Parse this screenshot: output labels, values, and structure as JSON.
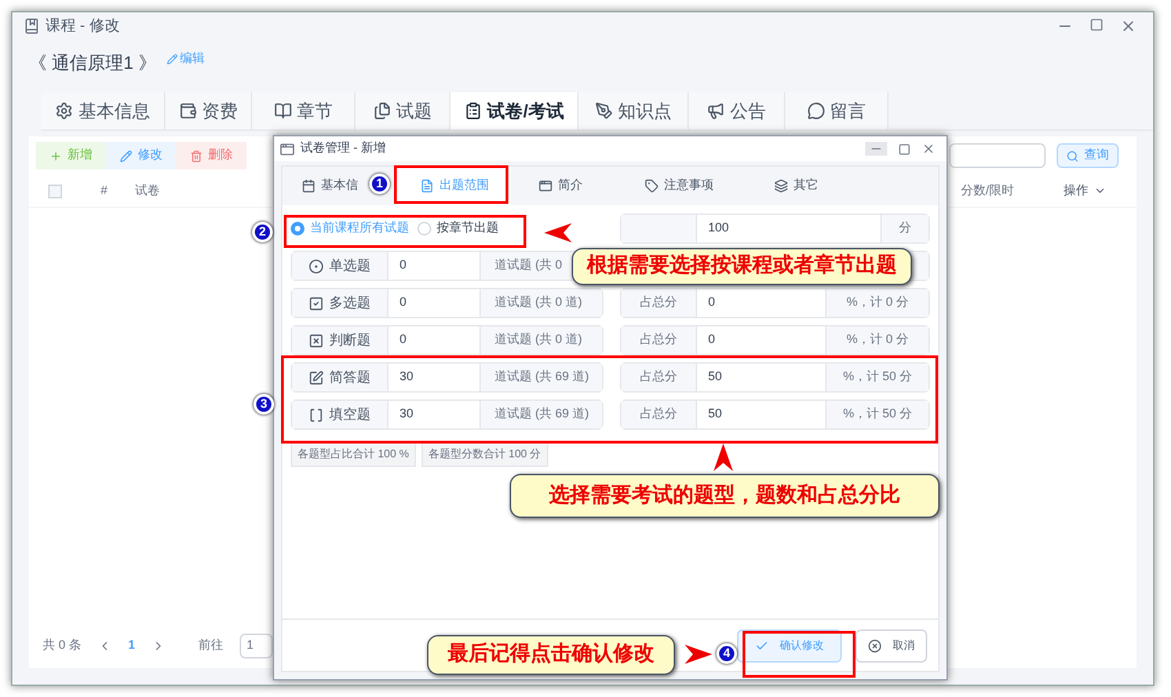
{
  "window": {
    "title": "课程 - 修改"
  },
  "course": {
    "title": "《 通信原理1 》",
    "edit_link": "编辑"
  },
  "tabs": [
    {
      "label": "基本信息",
      "selected": false
    },
    {
      "label": "资费",
      "selected": false
    },
    {
      "label": "章节",
      "selected": false
    },
    {
      "label": "试题",
      "selected": false
    },
    {
      "label": "试卷/考试",
      "selected": true
    },
    {
      "label": "知识点",
      "selected": false
    },
    {
      "label": "公告",
      "selected": false
    },
    {
      "label": "留言",
      "selected": false
    }
  ],
  "toolbar": [
    {
      "kind": "add",
      "label": "新增"
    },
    {
      "kind": "edit",
      "label": "修改"
    },
    {
      "kind": "delete",
      "label": "删除"
    }
  ],
  "search": {
    "button": "查询"
  },
  "table": {
    "select_all_checked": false,
    "columns": [
      "#",
      "试卷",
      "分数/限时",
      "操作"
    ]
  },
  "pager": {
    "total": "共 0 条",
    "page": "1",
    "goto": "前往",
    "goto_value": "1"
  },
  "dialog": {
    "title": "试卷管理 - 新增",
    "tabs": [
      {
        "label": "基本信",
        "selected": false
      },
      {
        "label": "出题范围",
        "selected": true
      },
      {
        "label": "简介",
        "selected": false
      },
      {
        "label": "注意事项",
        "selected": false
      },
      {
        "label": "其它",
        "selected": false
      }
    ],
    "source_options": [
      {
        "label": "当前课程所有试题",
        "selected": true
      },
      {
        "label": "按章节出题",
        "selected": false
      }
    ],
    "full_score": {
      "value": "100",
      "unit": "分"
    },
    "question_types": [
      {
        "kind": "single",
        "label": "单选题",
        "count": "0",
        "note": "道试题 (共 0"
      },
      {
        "kind": "multiple",
        "label": "多选题",
        "count": "0",
        "note": "道试题 (共 0 道)",
        "share_label": "占总分",
        "share": "0",
        "result": "%，计 0 分"
      },
      {
        "kind": "judge",
        "label": "判断题",
        "count": "0",
        "note": "道试题 (共 0 道)",
        "share_label": "占总分",
        "share": "0",
        "result": "%，计 0 分"
      },
      {
        "kind": "short",
        "label": "简答题",
        "count": "30",
        "note": "道试题 (共 69 道)",
        "share_label": "占总分",
        "share": "50",
        "result": "%，计 50 分"
      },
      {
        "kind": "blank",
        "label": "填空题",
        "count": "30",
        "note": "道试题 (共 69 道)",
        "share_label": "占总分",
        "share": "50",
        "result": "%，计 50 分"
      }
    ],
    "totals": [
      "各题型占比合计 100 %",
      "各题型分数合计 100 分"
    ],
    "buttons": [
      {
        "kind": "confirm",
        "label": "确认修改"
      },
      {
        "kind": "cancel",
        "label": "取消"
      }
    ]
  },
  "annotations": {
    "markers": [
      "1",
      "2",
      "3",
      "4"
    ],
    "callouts": [
      "根据需要选择按课程或者章节出题",
      "选择需要考试的题型，题数和占总分比",
      "最后记得点击确认修改"
    ]
  }
}
